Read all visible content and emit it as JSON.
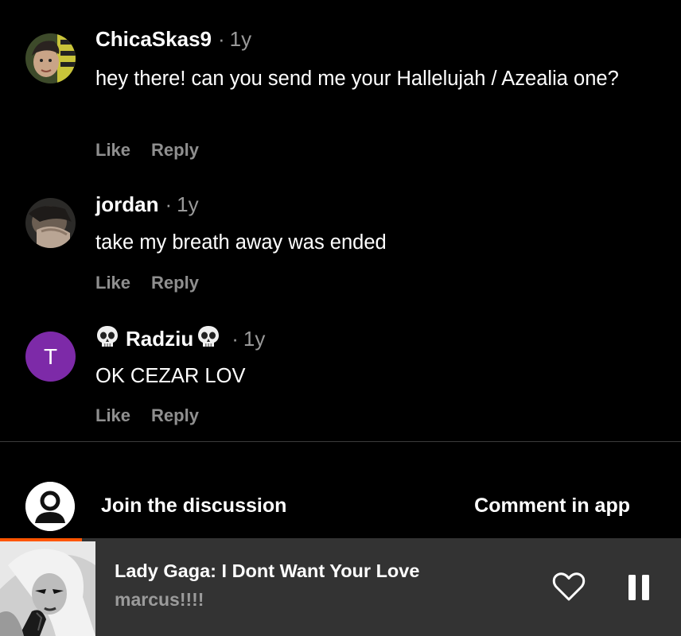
{
  "comments": [
    {
      "username": "ChicaSkas9",
      "age": "1y",
      "text": "hey there! can you send me your Hallelujah / Azealia one?",
      "avatar_icon": "user-photo-avatar",
      "like_label": "Like",
      "reply_label": "Reply"
    },
    {
      "username": "jordan",
      "age": "1y",
      "text": "take my breath away was ended",
      "avatar_icon": "user-photo-avatar",
      "like_label": "Like",
      "reply_label": "Reply"
    },
    {
      "username": "Radziu",
      "username_decoration": "skull-emoji",
      "age": "1y",
      "text": "OK CEZAR LOV",
      "avatar_letter": "T",
      "avatar_color": "#7d2aa8",
      "like_label": "Like",
      "reply_label": "Reply"
    }
  ],
  "separator": "·",
  "join": {
    "label": "Join the discussion",
    "avatar_icon": "default-user-icon",
    "comment_in_app": "Comment in app"
  },
  "player": {
    "title": "Lady Gaga: I Dont Want Your Love",
    "artist": "marcus!!!!",
    "progress_fraction": 0.12,
    "accent_color": "#ff5500",
    "heart_icon": "heart-outline-icon",
    "pause_icon": "pause-icon",
    "art_icon": "album-art"
  }
}
